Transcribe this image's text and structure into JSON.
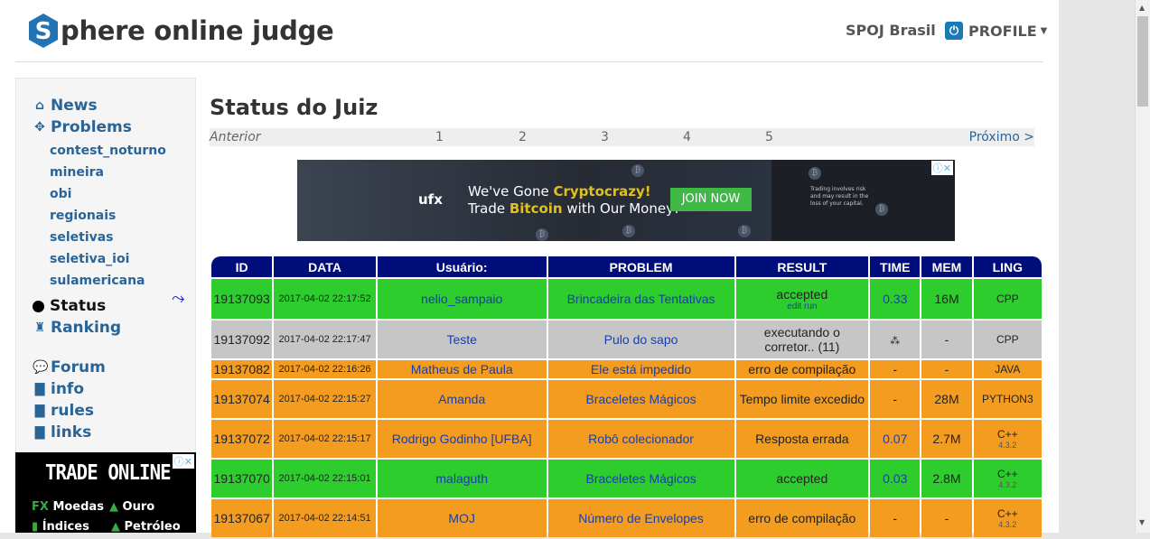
{
  "header": {
    "logo_letter": "S",
    "logo_text": "phere online judge",
    "spoj_brasil": "SPOJ Brasil",
    "profile_label": "PROFILE"
  },
  "sidebar": {
    "main_items": [
      {
        "label": "News",
        "icon": "home-icon"
      },
      {
        "label": "Problems",
        "icon": "puzzle-icon"
      }
    ],
    "problem_groups": [
      "contest_noturno",
      "mineira",
      "obi",
      "regionais",
      "seletivas",
      "seletiva_ioi",
      "sulamericana"
    ],
    "status_label": "Status",
    "ranking_label": "Ranking",
    "lower_items": [
      {
        "label": "Forum",
        "icon": "comments-icon"
      },
      {
        "label": "info",
        "icon": "file-icon"
      },
      {
        "label": "rules",
        "icon": "file-icon"
      },
      {
        "label": "links",
        "icon": "file-icon"
      }
    ],
    "ad": {
      "title": "TRADE ONLINE",
      "fx": "FX",
      "moedas": "Moedas",
      "ouro": "Ouro",
      "indices": "Índices",
      "petroleo": "Petróleo"
    }
  },
  "main": {
    "title": "Status do Juiz",
    "pager": {
      "prev": "Anterior",
      "pages": [
        "1",
        "2",
        "3",
        "4",
        "5"
      ],
      "next": "Próximo >"
    },
    "ad_banner": {
      "brand": "ufx",
      "line1_a": "We've Gone ",
      "line1_b": "Cryptocrazy!",
      "line2_a": "Trade ",
      "line2_b": "Bitcoin",
      "line2_c": " with Our Money!",
      "cta": "JOIN NOW",
      "fine_print": "Trading involves risk and may result in the loss of your capital."
    },
    "table": {
      "headers": [
        "ID",
        "DATA",
        "Usuário:",
        "PROBLEM",
        "RESULT",
        "TIME",
        "MEM",
        "LING"
      ],
      "rows": [
        {
          "id": "19137093",
          "date": "2017-04-02 22:17:52",
          "user": "nelio_sampaio",
          "problem": "Brincadeira das Tentativas",
          "result": "accepted",
          "result_links": "edit  run",
          "time": "0.33",
          "mem": "16M",
          "lang": "CPP",
          "lang_ver": "",
          "status": "green"
        },
        {
          "id": "19137092",
          "date": "2017-04-02 22:17:47",
          "user": "Teste",
          "problem": "Pulo do sapo",
          "result": "executando o corretor.. (11)",
          "result_links": "",
          "time": "",
          "mem": "-",
          "lang": "CPP",
          "lang_ver": "",
          "status": "grey"
        },
        {
          "id": "19137082",
          "date": "2017-04-02 22:16:26",
          "user": "Matheus de Paula",
          "problem": "Ele está impedido",
          "result": "erro de compilação",
          "result_links": "",
          "time": "-",
          "mem": "-",
          "lang": "JAVA",
          "lang_ver": "",
          "status": "orange"
        },
        {
          "id": "19137074",
          "date": "2017-04-02 22:15:27",
          "user": "Amanda",
          "problem": "Braceletes Mágicos",
          "result": "Tempo limite excedido",
          "result_links": "",
          "time": "-",
          "mem": "28M",
          "lang": "PYTHON3",
          "lang_ver": "",
          "status": "orange"
        },
        {
          "id": "19137072",
          "date": "2017-04-02 22:15:17",
          "user": "Rodrigo Godinho [UFBA]",
          "problem": "Robô colecionador",
          "result": "Resposta errada",
          "result_links": "",
          "time": "0.07",
          "mem": "2.7M",
          "lang": "C++",
          "lang_ver": "4.3.2",
          "status": "orange"
        },
        {
          "id": "19137070",
          "date": "2017-04-02 22:15:01",
          "user": "malaguth",
          "problem": "Braceletes Mágicos",
          "result": "accepted",
          "result_links": "",
          "time": "0.03",
          "mem": "2.8M",
          "lang": "C++",
          "lang_ver": "4.3.2",
          "status": "green"
        },
        {
          "id": "19137067",
          "date": "2017-04-02 22:14:51",
          "user": "MOJ",
          "problem": "Número de Envelopes",
          "result": "erro de compilação",
          "result_links": "",
          "time": "-",
          "mem": "-",
          "lang": "C++",
          "lang_ver": "4.3.2",
          "status": "orange"
        }
      ]
    }
  },
  "colors": {
    "header_navy": "#000e7c",
    "accepted_green": "#2ccd2c",
    "running_grey": "#c6c6c6",
    "error_orange": "#f39c1f",
    "link_blue": "#2a6496"
  }
}
